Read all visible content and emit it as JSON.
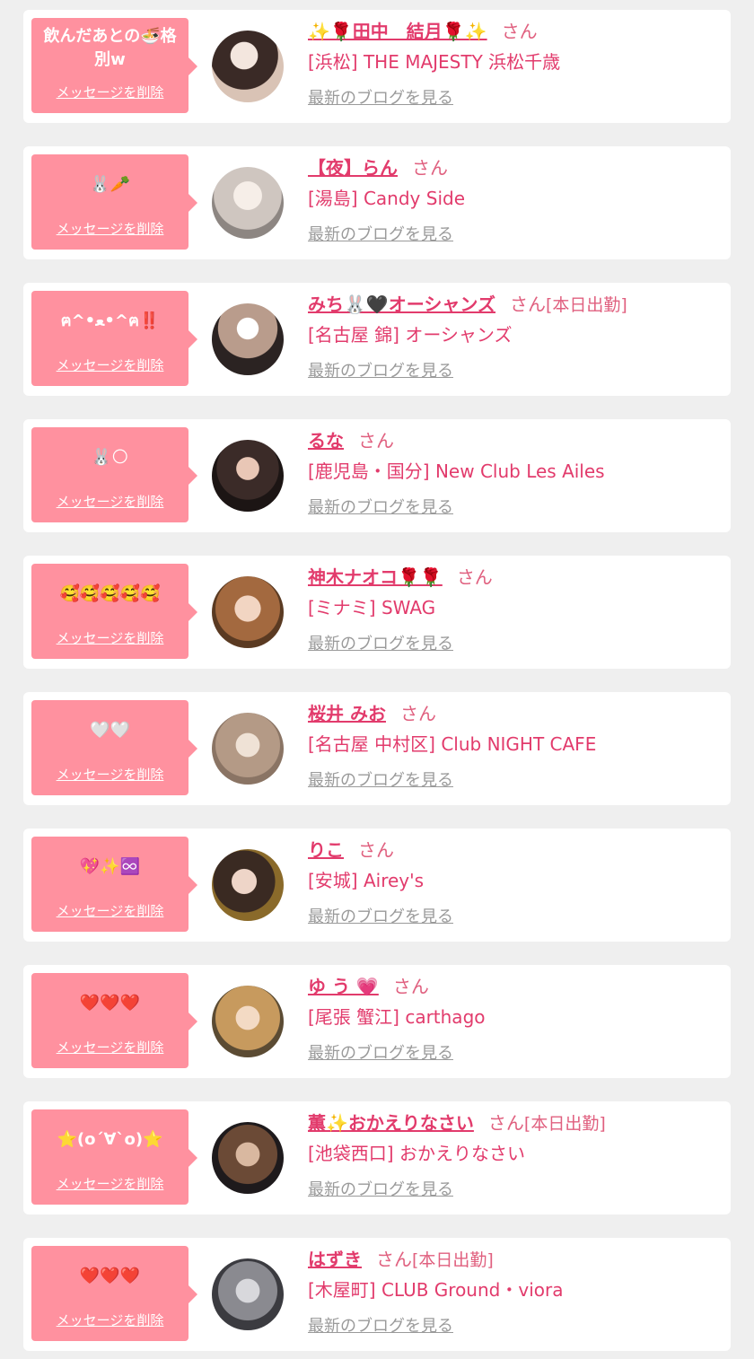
{
  "delete_label": "メッセージを削除",
  "blog_label": "最新のブログを見る",
  "san_label": "さん",
  "colors": {
    "bubble": "#ff919f",
    "accent": "#e23b6c",
    "page_bg": "#efefef"
  },
  "items": [
    {
      "message": "飲んだあとの🍜格別w",
      "name": "✨🌹田中　結月🌹✨",
      "work_status": "",
      "shop": "[浜松] THE MAJESTY 浜松千歳"
    },
    {
      "message": "🐰🥕",
      "name": "【夜】らん",
      "work_status": "",
      "shop": "[湯島] Candy Side"
    },
    {
      "message": "ฅ^•ﻌ•^ฅ‼️",
      "name": "みち🐰🖤オーシャンズ",
      "work_status": "[本日出勤]",
      "shop": "[名古屋 錦] オーシャンズ"
    },
    {
      "message": "🐰🌕",
      "name": "るな",
      "work_status": "",
      "shop": "[鹿児島・国分] New Club Les Ailes"
    },
    {
      "message": "🥰🥰🥰🥰🥰",
      "name": "神木ナオコ🌹🌹",
      "work_status": "",
      "shop": "[ミナミ] SWAG"
    },
    {
      "message": "🤍🤍",
      "name": "桜井 みお",
      "work_status": "",
      "shop": "[名古屋 中村区] Club NIGHT CAFE"
    },
    {
      "message": "💖✨♾️",
      "name": "りこ",
      "work_status": "",
      "shop": "[安城] Airey's"
    },
    {
      "message": "❤️❤️❤️",
      "name": "ゆ う 💗",
      "work_status": "",
      "shop": "[尾張 蟹江] carthago"
    },
    {
      "message": "⭐️(o´∀`o)⭐️",
      "name": "薫✨おかえりなさい",
      "work_status": "[本日出勤]",
      "shop": "[池袋西口] おかえりなさい"
    },
    {
      "message": "❤️❤️❤️",
      "name": "はずき",
      "work_status": "[本日出勤]",
      "shop": "[木屋町] CLUB Ground・viora"
    }
  ]
}
